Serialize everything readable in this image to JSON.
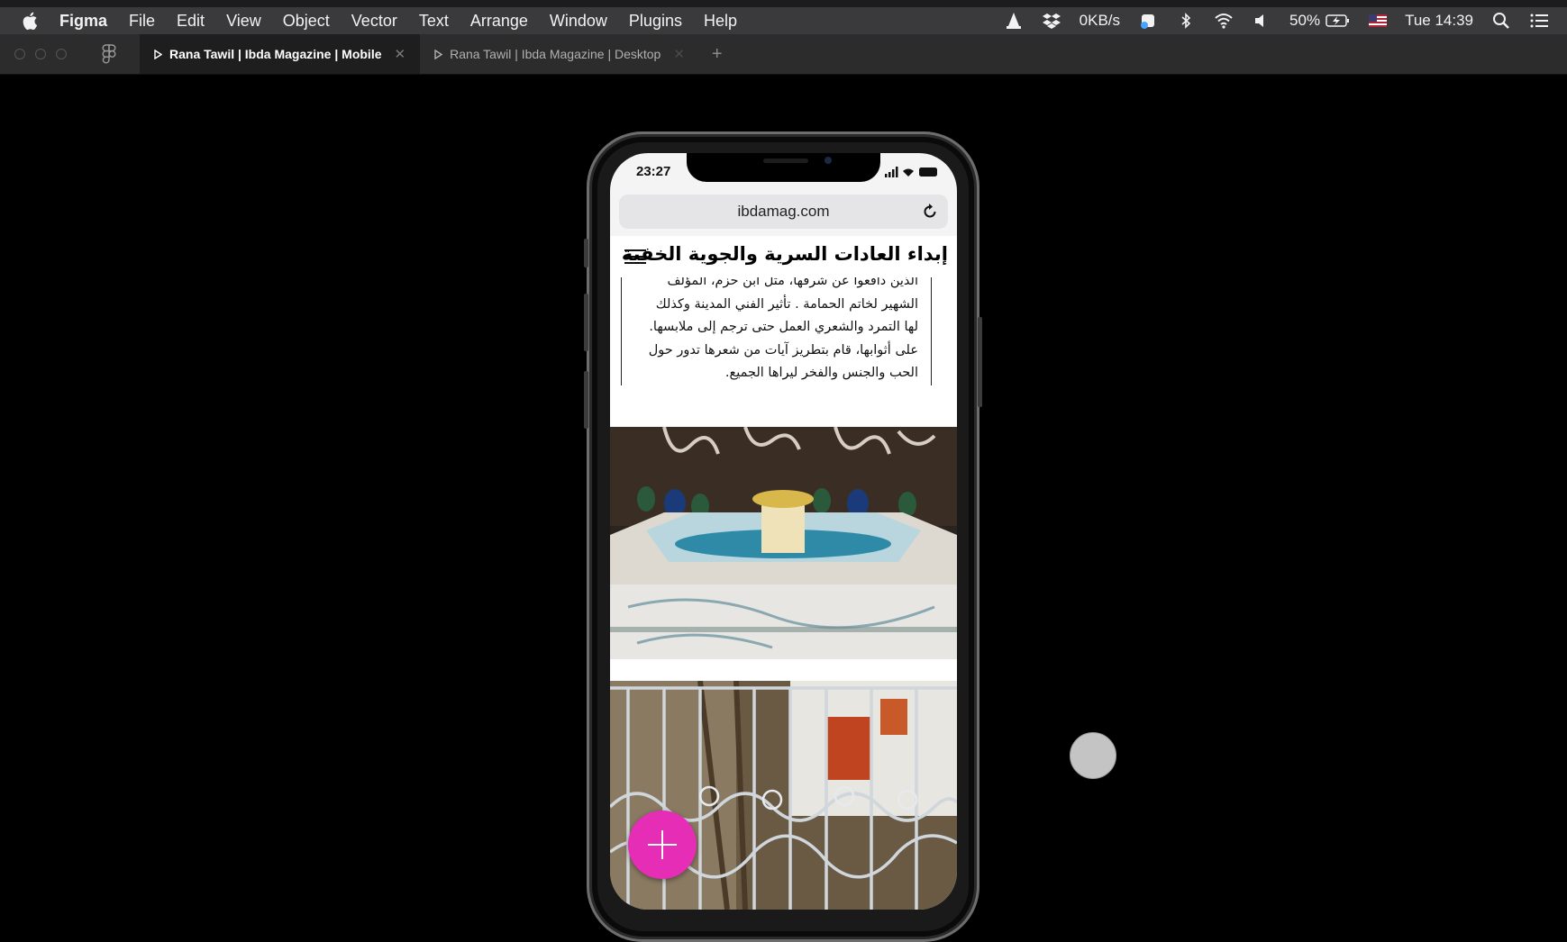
{
  "menubar": {
    "app_name": "Figma",
    "menus": [
      "File",
      "Edit",
      "View",
      "Object",
      "Vector",
      "Text",
      "Arrange",
      "Window",
      "Plugins",
      "Help"
    ],
    "network_speed": "0KB/s",
    "battery": "50%",
    "clock": "Tue 14:39"
  },
  "tabs": [
    {
      "label": "Rana Tawil | Ibda Magazine | Mobile",
      "active": true
    },
    {
      "label": "Rana Tawil | Ibda Magazine | Desktop",
      "active": false
    }
  ],
  "phone": {
    "time": "23:27",
    "url": "ibdamag.com",
    "site_title": "إبداء العادات السرية والجوية الخفية",
    "article_lines": [
      "الذين دافعوا عن شرفها، مثل ابن حزم، المؤلف",
      "الشهير لخاتم الحمامة . تأثير الفني المدينة وكذلك",
      "لها التمرد والشعري العمل حتى ترجم إلى ملابسها.",
      "على أثوابها، قام بتطريز آيات من شعرها تدور حول",
      "الحب والجنس والفخر ليراها الجميع."
    ],
    "accent_color": "#e52eb5"
  },
  "icons": {
    "apple": "apple-icon",
    "vlc": "vlc-icon",
    "dropbox": "dropbox-icon",
    "bluetooth": "bluetooth-icon",
    "wifi": "wifi-icon",
    "volume": "volume-icon",
    "search": "spotlight-search-icon",
    "notification": "notification-center-icon",
    "reload": "reload-icon",
    "menu": "hamburger-icon",
    "fab": "plus-icon"
  }
}
